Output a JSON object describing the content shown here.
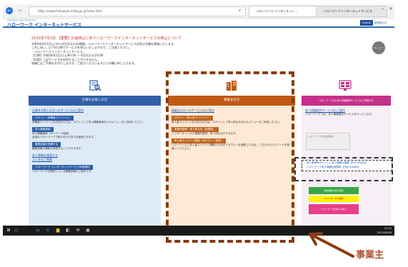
{
  "browser": {
    "url": "https://www.hellowork.mhlw.go.jp/index.html",
    "tabs": [
      "ハローワーク インターネット…",
      "ハローワークインターネットサービス"
    ],
    "back_icon": "back-arrow-icon",
    "forward_icon": "forward-arrow-icon"
  },
  "site": {
    "logo_small": "Hellowork Internet Service",
    "logo": "ハローワーク インターネットサービス",
    "header_buttons": [
      "English",
      "音声読上げ"
    ]
  },
  "notice": {
    "title": "2023年7月3日 【重要】計画停止に伴うハローワークインターネットサービスの停止について",
    "lines": [
      "令和5年9月1日(土)から9月3日(火)の期間、ハローワークインターネットサービスは停止作業を実施いたします。",
      "これに伴い、以下の日時でサービスを停止いたしますので、ご注意ください。",
      "・ハローワークインターネットサービス",
      "【日時】令和5年9月1日(土)00:00 〜 9月3日(火)24:00",
      "【内容】上記サービスを利用することができません。",
      "皆様にはご不便をおかけしますが、ご協力くださいますようお願い申し上げます。"
    ]
  },
  "menu_bubble": "メニュー",
  "columns": {
    "job_seekers": {
      "heading": "仕事をお探しの方",
      "links": [
        "仕事をお探しの方へのサービスのご案内",
        "求人情報を検索する",
        "よくあるご質問"
      ],
      "buttons": [
        "ログイン（求職者マイページ）",
        "求人情報検索",
        "職業訓練を受講する",
        "ハローワーク インターネットサービス利用規約"
      ],
      "descs": [
        "求職者マイページをお持ちの方は、ログインして求人情報検索などのメニューをご利用ください。",
        "求人情報検索（キーワード検索）",
        "全国のハローワークで受け付けた求人を検索できます。",
        "職業訓練の情報を検索することができます。",
        "ハローワークが提供している職業訓練のご案内です。"
      ]
    },
    "employers": {
      "heading": "事業主の方",
      "links": [
        "事業主の方へのサービスのご案内"
      ],
      "buttons": [
        "ログイン（求人者マイページ）",
        "事業所登録・求人申込み（仮登録）",
        "求人者マイページ開設（IDログイン登録）"
      ],
      "descs": [
        "求人者マイページをお持ちの方は、ログインして求人申込みなどのメニューをご利用ください。",
        "インターネットから事業所登録・求人申込みができます。",
        "ハローワークに求人者マイページ開設のためのアカウントを登録した方は、こちらからパスワードを登録してください。"
      ]
    },
    "notices": {
      "heading": "ハローワークから求人情報提供サービスのご利用の方",
      "links": [
        "求人情報提供サービスのご案内",
        "ハローワークの所在地情報"
      ],
      "descs": [
        "ハローワークでは、求人情報提供サービスを行っています。"
      ],
      "square_buttons": [
        "求人事業所のサイトに求人情報を掲載【PDF:500KB】",
        "ハローワーク求人情報利用規約【PDF:400KB】"
      ],
      "green_label": "雇用保険の電子申請",
      "yellow_label": "マイナポータル連携",
      "pink_label": "ハローワークの求人を使う"
    }
  },
  "taskbar": {
    "icons": [
      "windows-start-icon",
      "search-icon",
      "task-view-icon",
      "edge-icon",
      "explorer-icon",
      "store-icon",
      "mail-icon",
      "photos-icon"
    ],
    "time": "15:43",
    "date": "2023/08/08"
  },
  "caption": "事業主"
}
